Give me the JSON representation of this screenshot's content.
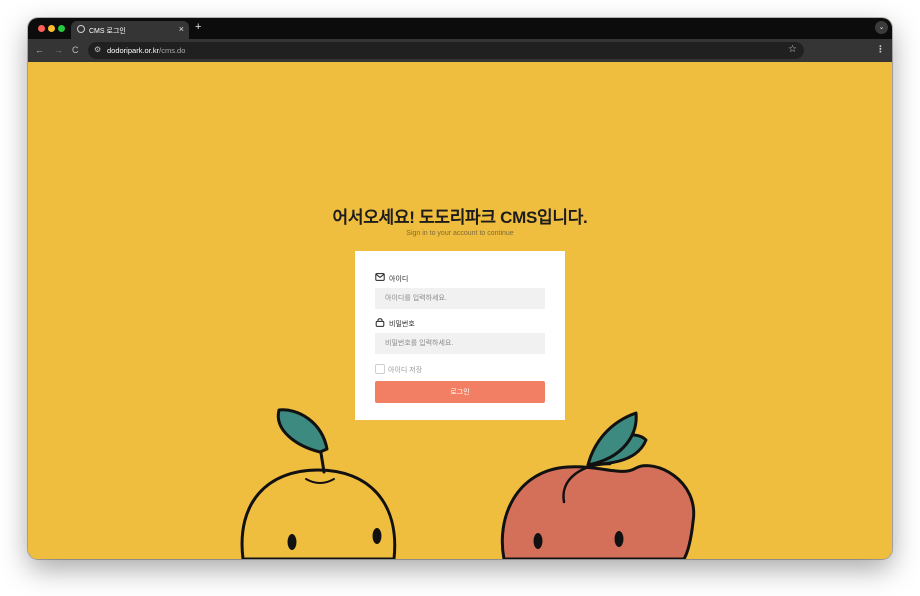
{
  "browser": {
    "tab_title": "CMS 로그인",
    "tab_close": "×",
    "new_tab": "+",
    "tabs_menu": "⌄",
    "nav_back": "←",
    "nav_forward": "→",
    "nav_reload": "C",
    "url_host": "dodoripark.or.kr",
    "url_path": "/cms.do",
    "bookmark_star": "☆",
    "menu": "⋮"
  },
  "page": {
    "heading": "어서오세요! 도도리파크 CMS입니다.",
    "subheading": "Sign in to your account to continue"
  },
  "login": {
    "id_label": "아이디",
    "id_placeholder": "아이디를 입력하세요.",
    "id_value": "",
    "password_label": "비밀번호",
    "password_placeholder": "비밀번호를 입력하세요.",
    "password_value": "",
    "remember_label": "아이디 저장",
    "remember_checked": false,
    "submit_label": "로그인"
  },
  "colors": {
    "page_background": "#f0be3f",
    "button": "#f27f63",
    "card": "#ffffff",
    "mascot_peach": "#d4705a",
    "mascot_leaf": "#3d8a80"
  }
}
